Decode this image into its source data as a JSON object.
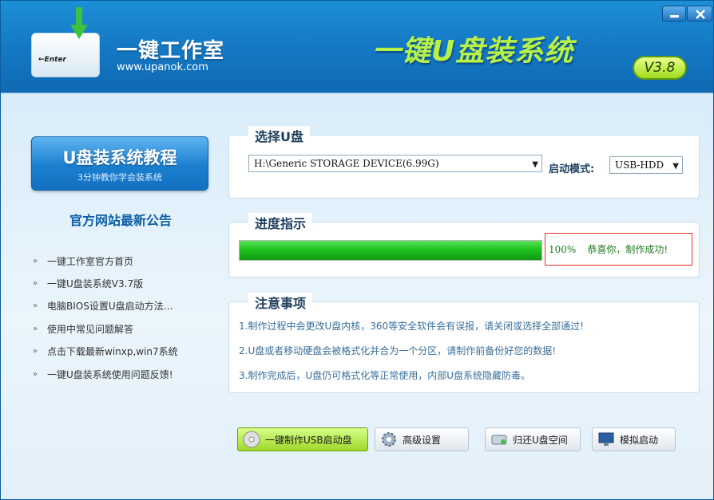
{
  "window": {
    "brand_title": "一键工作室",
    "brand_url": "www.upanok.com",
    "app_title": "一键U盘装系统",
    "version": "V3.8",
    "logo_enter_text": "←Enter"
  },
  "sidebar": {
    "tutorial_title": "U盘装系统教程",
    "tutorial_subtitle": "3分钟教你学会装系统",
    "news_heading": "官方网站最新公告",
    "news_items": [
      "一键工作室官方首页",
      "一键U盘装系统V3.7版",
      "电脑BIOS设置U盘启动方法…",
      "使用中常见问题解答",
      "点击下载最新winxp,win7系统",
      "一键U盘装系统使用问题反馈!"
    ],
    "bullet": "»"
  },
  "select_usb": {
    "legend": "选择U盘",
    "device_value": "H:\\Generic STORAGE DEVICE(6.99G)",
    "boot_mode_label": "启动模式:",
    "boot_mode_value": "USB-HDD"
  },
  "progress": {
    "legend": "进度指示",
    "percent": 100,
    "percent_text": "100%",
    "status_text": "恭喜你，制作成功!"
  },
  "notes": {
    "legend": "注意事项",
    "lines": [
      "1.制作过程中会更改U盘内核，360等安全软件会有误报，请关闭或选择全部通过!",
      "2.U盘或者移动硬盘会被格式化并合为一个分区，请制作前备份好您的数据!",
      "3.制作完成后，U盘仍可格式化等正常使用，内部U盘系统隐藏防毒。"
    ]
  },
  "actions": {
    "make_usb": "一键制作USB启动盘",
    "advanced": "高级设置",
    "restore": "归还U盘空间",
    "simulate": "模拟启动"
  },
  "colors": {
    "header_blue": "#1478c4",
    "title_green": "#b8f04a",
    "progress_green": "#1fc21f",
    "status_red_border": "#e53030"
  }
}
